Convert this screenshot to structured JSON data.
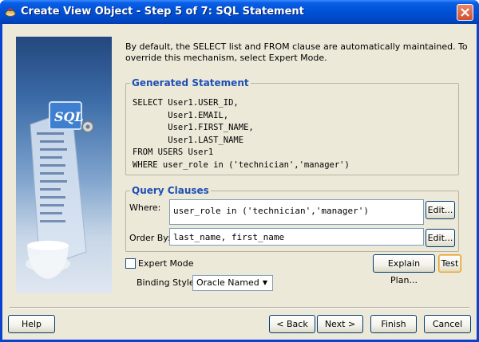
{
  "window": {
    "title": "Create View Object - Step 5 of 7: SQL Statement"
  },
  "intro_text": "By default, the SELECT list and FROM clause are automatically maintained.  To override this mechanism, select Expert Mode.",
  "generated_statement": {
    "label": "Generated Statement",
    "lines": [
      "SELECT User1.USER_ID,",
      "       User1.EMAIL,",
      "       User1.FIRST_NAME,",
      "       User1.LAST_NAME",
      "FROM USERS User1",
      "WHERE user_role in ('technician','manager')"
    ]
  },
  "query_clauses": {
    "label": "Query Clauses",
    "where_label": "Where:",
    "where_value": "user_role in ('technician','manager')",
    "where_edit": "Edit...",
    "orderby_label": "Order By:",
    "orderby_value": "last_name, first_name",
    "orderby_edit": "Edit..."
  },
  "expert_mode": {
    "label": "Expert Mode",
    "checked": false
  },
  "explain_plan_button": "Explain Plan...",
  "test_button": "Test",
  "binding_style": {
    "label": "Binding Style:",
    "selected": "Oracle Named"
  },
  "footer": {
    "help": "Help",
    "back": "< Back",
    "next": "Next >",
    "finish": "Finish",
    "cancel": "Cancel"
  },
  "colors": {
    "titlebar": "#0052d6",
    "dialog_bg": "#ece9d8",
    "group_label": "#1f4fb5"
  }
}
